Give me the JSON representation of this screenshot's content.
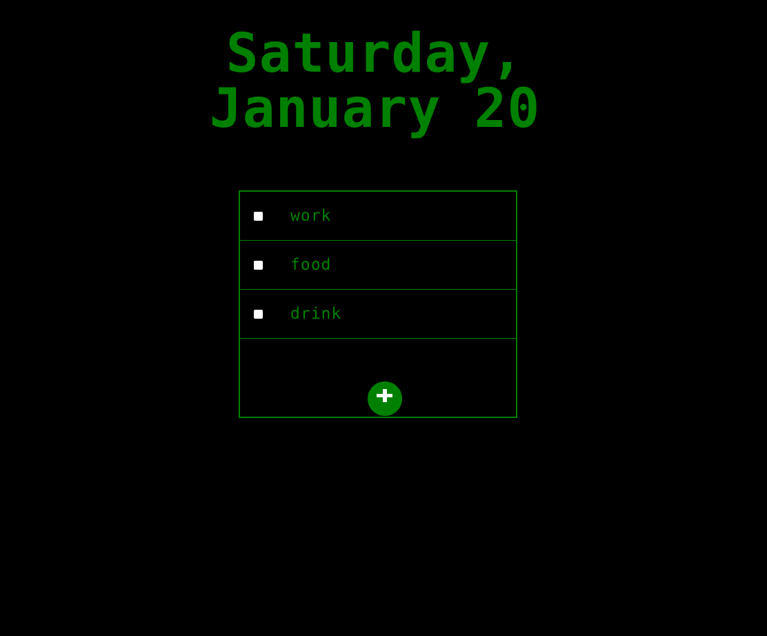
{
  "header": {
    "line1": "Saturday,",
    "line2": "January 20"
  },
  "todos": [
    {
      "label": "work",
      "checked": false
    },
    {
      "label": "food",
      "checked": false
    },
    {
      "label": "drink",
      "checked": false
    }
  ],
  "colors": {
    "background": "#000000",
    "accent": "#008000",
    "checkbox": "#ffffff"
  },
  "add_button": {
    "icon": "plus-icon"
  }
}
